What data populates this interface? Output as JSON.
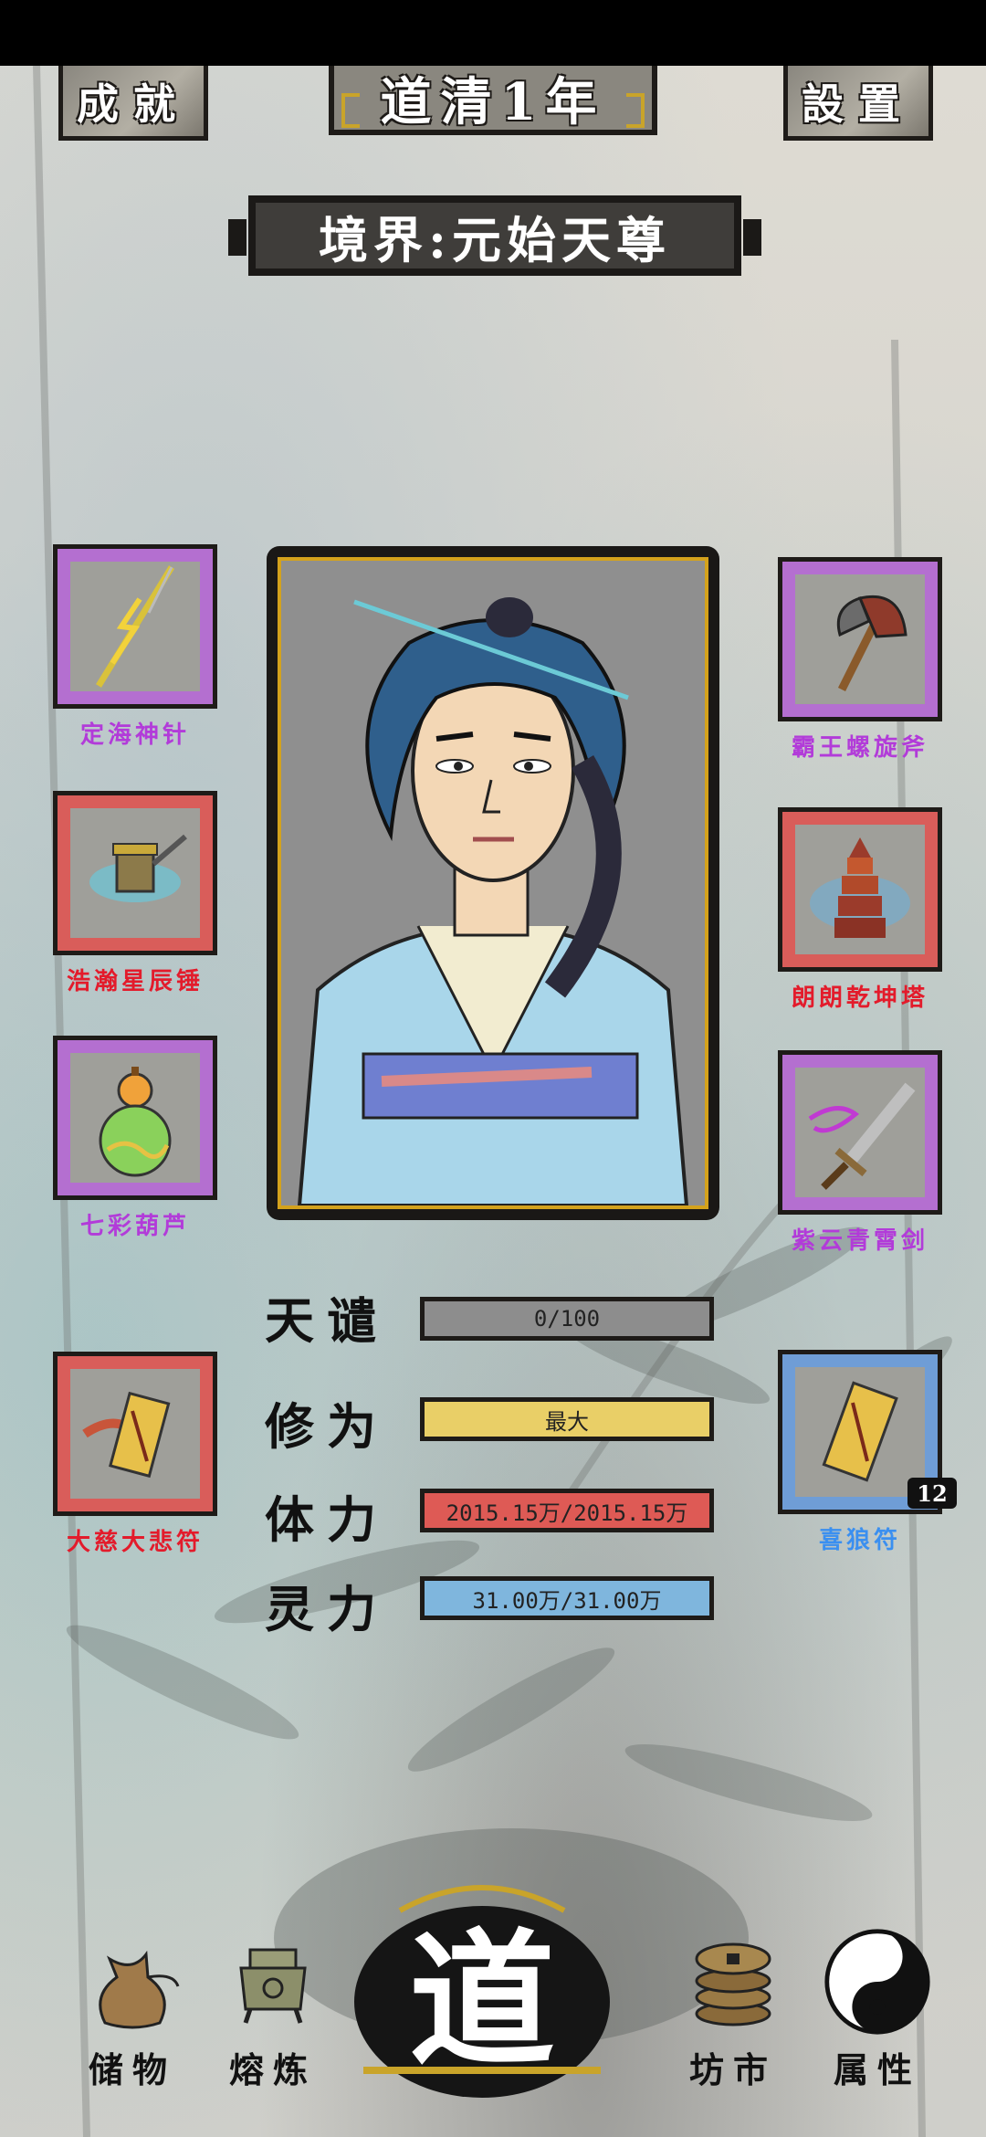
{
  "header": {
    "achievements_label": "成就",
    "title": "道清1年",
    "settings_label": "設置",
    "realm": "境界:元始天尊"
  },
  "left_items": [
    {
      "name": "定海神针",
      "rarity": "purple"
    },
    {
      "name": "浩瀚星辰锤",
      "rarity": "red"
    },
    {
      "name": "七彩葫芦",
      "rarity": "purple"
    },
    {
      "name": "大慈大悲符",
      "rarity": "red"
    }
  ],
  "right_items": [
    {
      "name": "霸王螺旋斧",
      "rarity": "purple"
    },
    {
      "name": "朗朗乾坤塔",
      "rarity": "red"
    },
    {
      "name": "紫云青霄剑",
      "rarity": "purple"
    },
    {
      "name": "喜狼符",
      "rarity": "blue",
      "count": "12"
    }
  ],
  "stats": {
    "tianqian": {
      "label": "天谴",
      "text": "0/100",
      "fraction": 0.0
    },
    "xiuwei": {
      "label": "修为",
      "text": "最大",
      "fraction": 1.0
    },
    "tili": {
      "label": "体力",
      "text": "2015.15万/2015.15万",
      "fraction": 1.0
    },
    "lingli": {
      "label": "灵力",
      "text": "31.00万/31.00万",
      "fraction": 1.0
    }
  },
  "colors": {
    "tianqian_bar": "#8d8d8d",
    "xiuwei_bar": "#e9cf67",
    "tili_bar": "#de5a55",
    "lingli_bar": "#7fb6dd"
  },
  "nav": {
    "storage": "储物",
    "forge": "熔炼",
    "center": "道",
    "market": "坊市",
    "attributes": "属性"
  }
}
